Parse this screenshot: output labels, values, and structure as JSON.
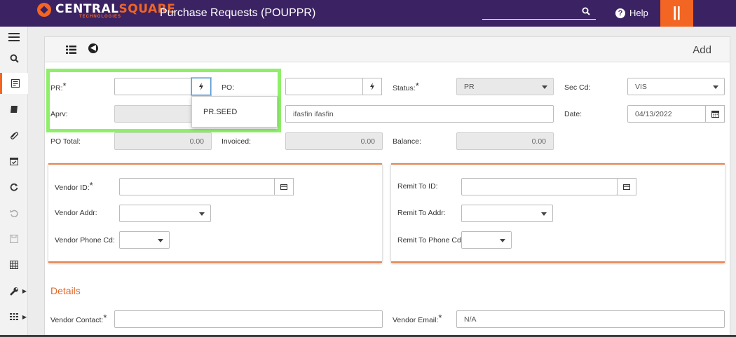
{
  "brand": {
    "name_part1": "CENTRAL",
    "name_part2": "SQUARE",
    "sub": "TECHNOLOGIES"
  },
  "app_title": "Purchase Requests (POUPPR)",
  "header": {
    "help_label": "Help",
    "menu_glyph": "||"
  },
  "sidebar": {
    "items": [
      {
        "icon": "hamburger-icon",
        "glyph": "☰"
      },
      {
        "icon": "search-icon",
        "glyph": "🔍"
      },
      {
        "icon": "form-icon",
        "glyph": "▤"
      },
      {
        "icon": "book-icon",
        "glyph": "▰"
      },
      {
        "icon": "paperclip-icon",
        "glyph": "⌇"
      },
      {
        "icon": "calendar-check-icon",
        "glyph": "▣"
      },
      {
        "icon": "refresh-icon",
        "glyph": "⟳"
      },
      {
        "icon": "undo-icon",
        "glyph": "↺"
      },
      {
        "icon": "save-icon",
        "glyph": "▢"
      },
      {
        "icon": "grid-icon",
        "glyph": "▦"
      },
      {
        "icon": "wrench-icon",
        "glyph": "✎"
      },
      {
        "icon": "apps-icon",
        "glyph": "▦"
      }
    ]
  },
  "panel": {
    "mode": "Add"
  },
  "form": {
    "pr_label": "PR:",
    "pr_value": "",
    "po_label": "PO:",
    "po_value": "",
    "status_label": "Status:",
    "status_value": "PR",
    "sec_cd_label": "Sec Cd:",
    "sec_cd_value": "VIS",
    "aprv_label": "Aprv:",
    "aprv_value": "",
    "requestor_value": "ifasfin ifasfin",
    "date_label": "Date:",
    "date_value": "04/13/2022",
    "po_total_label": "PO Total:",
    "po_total_value": "0.00",
    "invoiced_label": "Invoiced:",
    "invoiced_value": "0.00",
    "balance_label": "Balance:",
    "balance_value": "0.00",
    "required_mark": "*"
  },
  "dropdown": {
    "option": "PR.SEED"
  },
  "vendor": {
    "vendor_id_label": "Vendor ID:",
    "vendor_addr_label": "Vendor Addr:",
    "vendor_phone_label": "Vendor Phone Cd:",
    "remit_id_label": "Remit To ID:",
    "remit_addr_label": "Remit To Addr:",
    "remit_phone_label": "Remit To Phone Cd:"
  },
  "details": {
    "title": "Details",
    "vendor_contact_label": "Vendor Contact:",
    "vendor_email_label": "Vendor Email:",
    "vendor_email_value": "N/A"
  },
  "colors": {
    "topbar": "#3b2363",
    "accent": "#f26522",
    "highlight": "#8fef6a"
  }
}
